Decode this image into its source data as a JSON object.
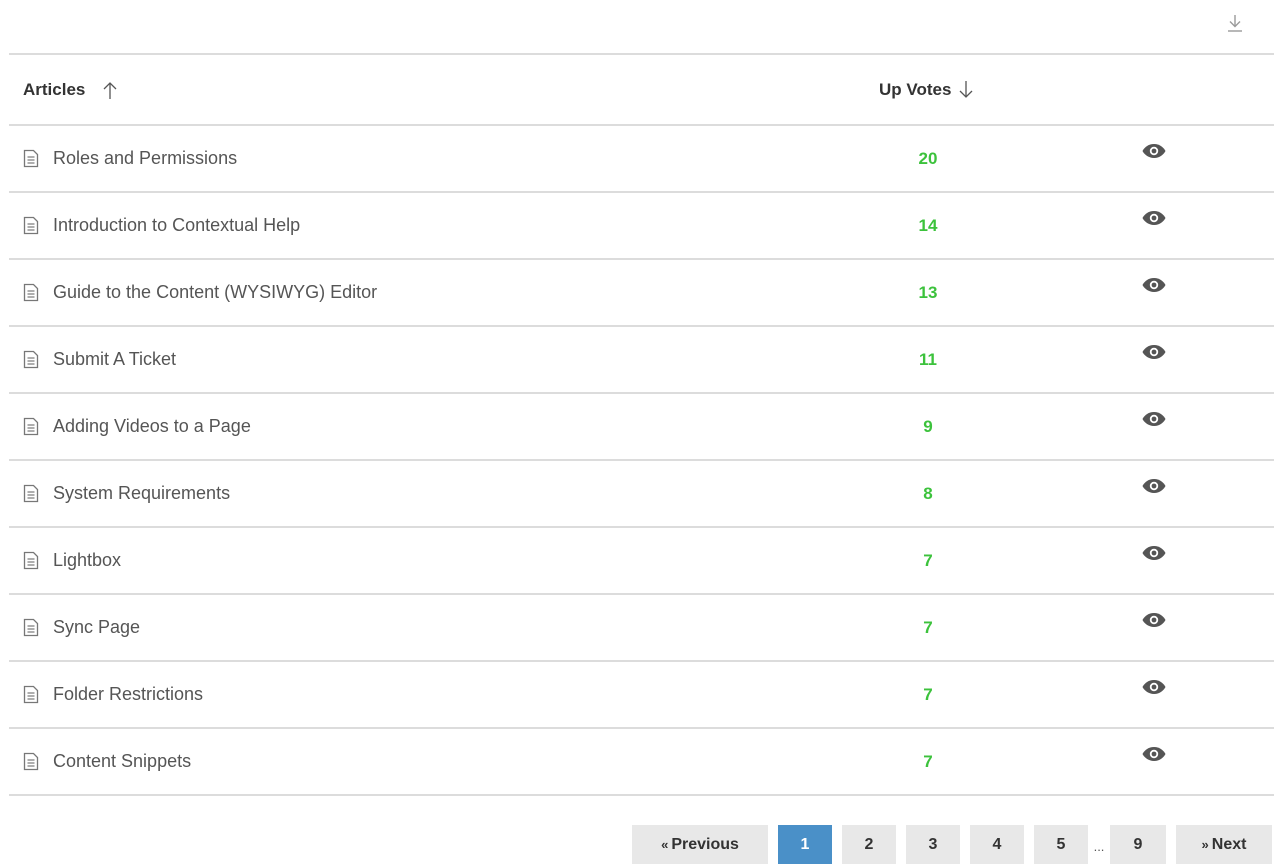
{
  "toolbar": {
    "download_icon": "download-icon"
  },
  "table": {
    "headers": {
      "articles": "Articles",
      "up_votes": "Up Votes"
    },
    "rows": [
      {
        "title": "Roles and Permissions",
        "votes": "20"
      },
      {
        "title": "Introduction to Contextual Help",
        "votes": "14"
      },
      {
        "title": "Guide to the Content (WYSIWYG) Editor",
        "votes": "13"
      },
      {
        "title": "Submit A Ticket",
        "votes": "11"
      },
      {
        "title": "Adding Videos to a Page",
        "votes": "9"
      },
      {
        "title": "System Requirements",
        "votes": "8"
      },
      {
        "title": "Lightbox",
        "votes": "7"
      },
      {
        "title": "Sync Page",
        "votes": "7"
      },
      {
        "title": "Folder Restrictions",
        "votes": "7"
      },
      {
        "title": "Content Snippets",
        "votes": "7"
      }
    ]
  },
  "pagination": {
    "previous": "Previous",
    "next": "Next",
    "prev_glyph": "«",
    "next_glyph": "»",
    "pages": [
      "1",
      "2",
      "3",
      "4",
      "5"
    ],
    "ellipsis": "...",
    "last": "9",
    "current": "1"
  },
  "colors": {
    "votes": "#3cc23c",
    "active_page": "#4a90c8",
    "page_bg": "#e8e8e8",
    "divider": "#dcdcdc"
  }
}
